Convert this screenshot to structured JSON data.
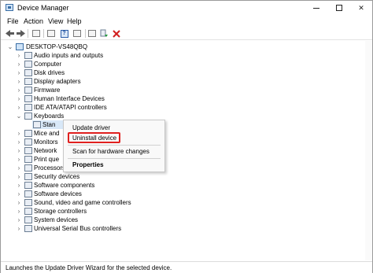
{
  "window": {
    "title": "Device Manager"
  },
  "window_controls": {
    "minimize": "—",
    "maximize": "☐",
    "close": "✕"
  },
  "menu": [
    "File",
    "Action",
    "View",
    "Help"
  ],
  "toolbar": {
    "icons": [
      "back-arrow",
      "forward-arrow",
      "show-hide-tree",
      "properties",
      "help",
      "update-driver",
      "scan-hardware",
      "remove-device"
    ]
  },
  "tree": {
    "root": "DESKTOP-VS48QBQ",
    "items": [
      {
        "label": "Audio inputs and outputs",
        "expanded": false
      },
      {
        "label": "Computer",
        "expanded": false
      },
      {
        "label": "Disk drives",
        "expanded": false
      },
      {
        "label": "Display adapters",
        "expanded": false
      },
      {
        "label": "Firmware",
        "expanded": false
      },
      {
        "label": "Human Interface Devices",
        "expanded": false
      },
      {
        "label": "IDE ATA/ATAPI controllers",
        "expanded": false
      },
      {
        "label": "Keyboards",
        "expanded": true
      },
      {
        "label": "Stan",
        "child": true,
        "selected": true
      },
      {
        "label": "Mice and",
        "expanded": false
      },
      {
        "label": "Monitors",
        "expanded": false
      },
      {
        "label": "Network",
        "expanded": false
      },
      {
        "label": "Print que",
        "expanded": false
      },
      {
        "label": "Processors",
        "expanded": false
      },
      {
        "label": "Security devices",
        "expanded": false
      },
      {
        "label": "Software components",
        "expanded": false
      },
      {
        "label": "Software devices",
        "expanded": false
      },
      {
        "label": "Sound, video and game controllers",
        "expanded": false
      },
      {
        "label": "Storage controllers",
        "expanded": false
      },
      {
        "label": "System devices",
        "expanded": false
      },
      {
        "label": "Universal Serial Bus controllers",
        "expanded": false
      }
    ]
  },
  "context_menu": {
    "items": [
      "Update driver",
      "Uninstall device",
      "Scan for hardware changes",
      "Properties"
    ],
    "highlight_color": "#e0201f"
  },
  "status": {
    "text": "Launches the Update Driver Wizard for the selected device."
  }
}
